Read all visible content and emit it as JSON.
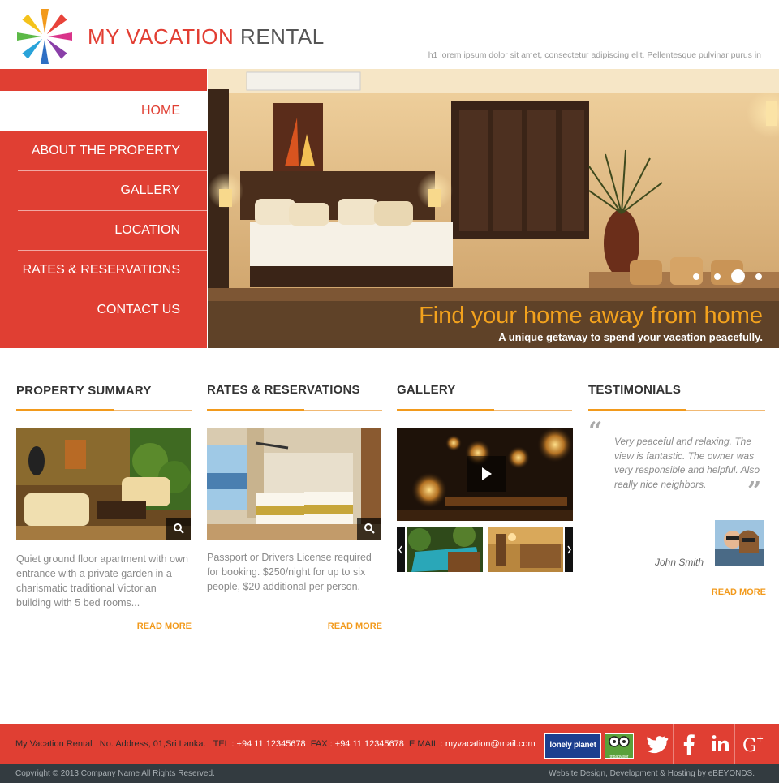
{
  "header": {
    "brand_primary": "MY VACATION",
    "brand_secondary": "RENTAL",
    "tagline": "h1 lorem ipsum dolor sit amet, consectetur adipiscing elit. Pellentesque pulvinar purus in"
  },
  "nav": {
    "items": [
      {
        "label": "HOME",
        "active": true
      },
      {
        "label": "ABOUT THE PROPERTY"
      },
      {
        "label": "GALLERY"
      },
      {
        "label": "LOCATION"
      },
      {
        "label": "RATES  & RESERVATIONS"
      },
      {
        "label": "CONTACT US"
      }
    ]
  },
  "hero": {
    "title": "Find your home away from home",
    "subtitle": "A unique getaway to spend your vacation peacefully.",
    "slides": 4,
    "active_slide": 3
  },
  "sections": {
    "summary": {
      "title": "PROPERTY SUMMARY",
      "text": "Quiet ground floor apartment with own entrance with a private garden in a charismatic traditional Victorian building with 5 bed rooms...",
      "read_more": "READ MORE"
    },
    "rates": {
      "title": "RATES & RESERVATIONS",
      "text": "Passport or Drivers License required for booking. $250/night for up to six people, $20 additional per person.",
      "read_more": "READ MORE"
    },
    "gallery": {
      "title": "GALLERY"
    },
    "testimonials": {
      "title": "TESTIMONIALS",
      "quote": "Very peaceful and relaxing. The view is fantastic. The owner was very responsible and helpful. Also really nice neighbors.",
      "author": "John Smith",
      "read_more": "READ MORE"
    }
  },
  "footer": {
    "company": "My Vacation Rental",
    "address": "No. Address, 01,Sri Lanka.",
    "tel_label": "TEL",
    "tel": "+94 11 12345678",
    "fax_label": "FAX",
    "fax": "+94 11 12345678",
    "email_label": "E MAIL",
    "email": "myvacation@mail.com",
    "badges": [
      "lonely planet",
      "tripadvisor"
    ],
    "social": [
      "twitter-icon",
      "facebook-icon",
      "linkedin-icon",
      "google-plus-icon"
    ],
    "copyright": "Copyright © 2013 Company Name All Rights Reserved.",
    "credit": "Website Design, Development & Hosting by eBEYONDS."
  },
  "colors": {
    "brand_red": "#e03f33",
    "accent_orange": "#f29a1c",
    "footer_dark": "#333b40"
  }
}
